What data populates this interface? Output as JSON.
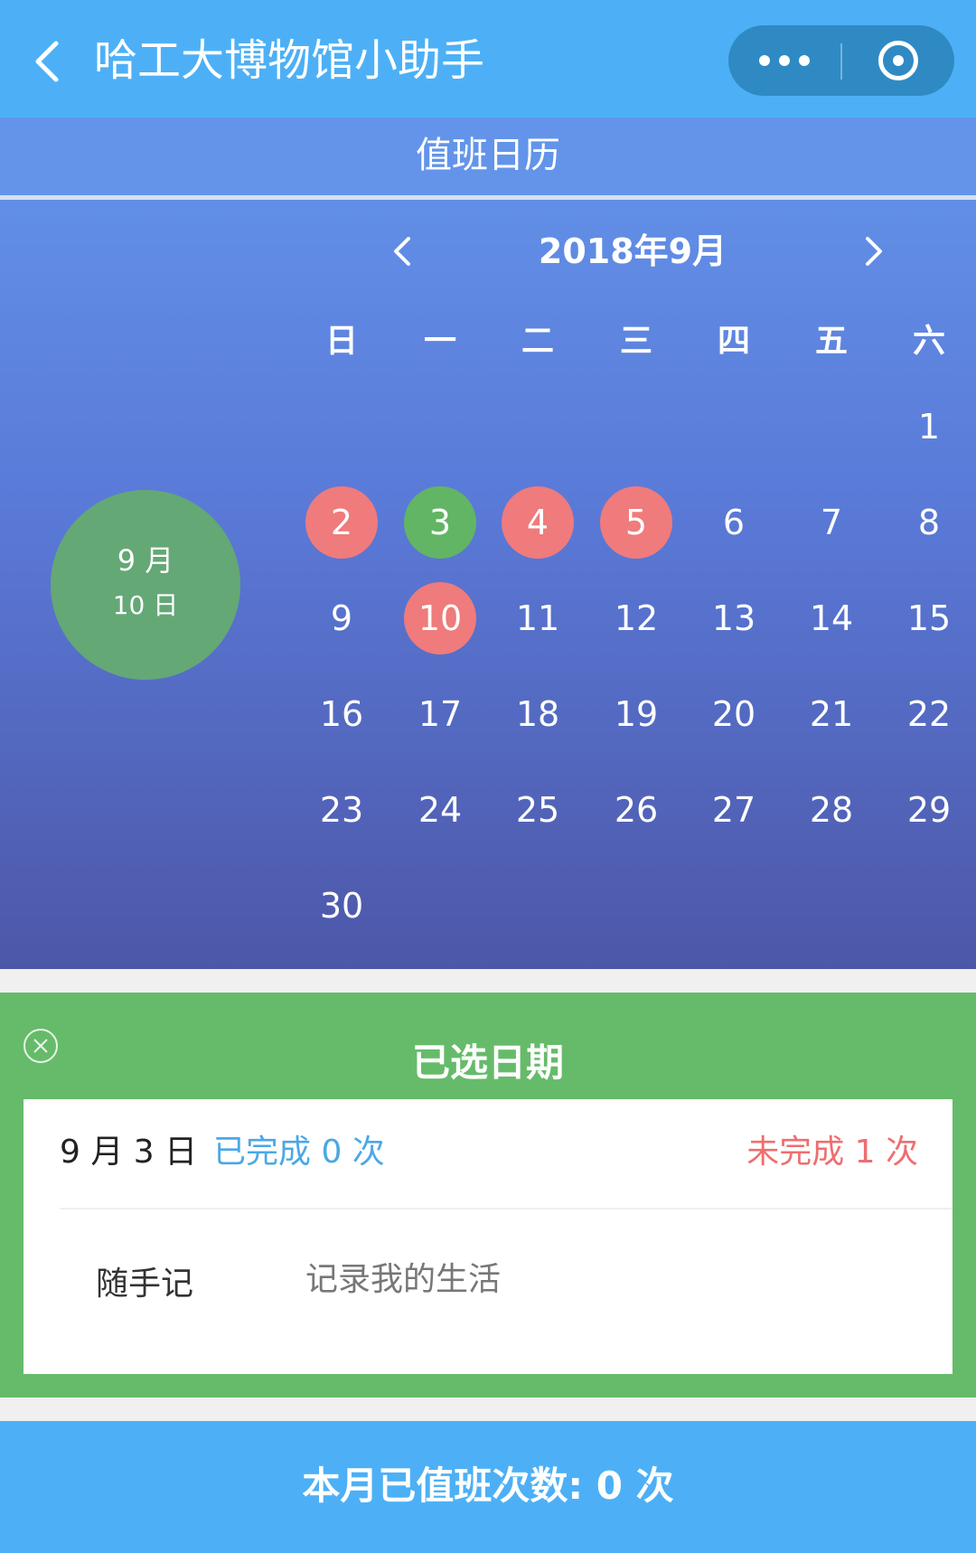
{
  "navbar": {
    "title": "哈工大博物馆小助手",
    "back_icon": "chevron-left-icon",
    "more_icon": "more-dots-icon",
    "close_icon": "target-icon"
  },
  "calendar": {
    "section_title": "值班日历",
    "month_label": "2018年9月",
    "weekdays": [
      "日",
      "一",
      "二",
      "三",
      "四",
      "五",
      "六"
    ],
    "days": [
      "1",
      "2",
      "3",
      "4",
      "5",
      "6",
      "7",
      "8",
      "9",
      "10",
      "11",
      "12",
      "13",
      "14",
      "15",
      "16",
      "17",
      "18",
      "19",
      "20",
      "21",
      "22",
      "23",
      "24",
      "25",
      "26",
      "27",
      "28",
      "29",
      "30"
    ],
    "highlight_colors": {
      "red": "#ef7b7c",
      "green": "#62b564"
    },
    "red_days": [
      "2",
      "4",
      "5",
      "10"
    ],
    "green_days": [
      "3"
    ],
    "today": {
      "month": "9 月",
      "day": "10 日"
    }
  },
  "selected": {
    "title": "已选日期",
    "date": "9 月 3 日",
    "done": "已完成 0 次",
    "undone": "未完成 1 次",
    "note_label": "随手记",
    "note_placeholder": "记录我的生活",
    "close_icon": "close-circle-icon"
  },
  "footer": {
    "summary": "本月已值班次数: 0 次"
  }
}
